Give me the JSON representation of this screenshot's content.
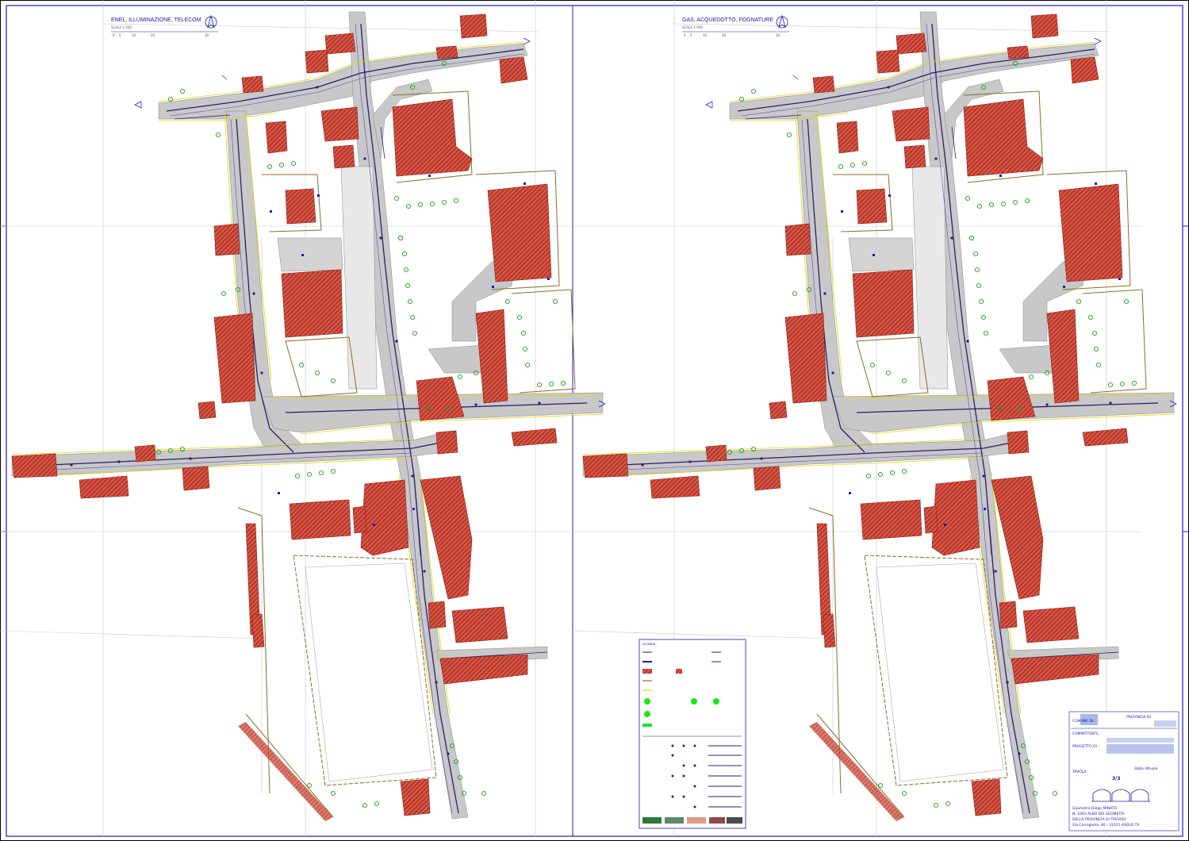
{
  "panels": [
    {
      "title": "ENEL, ILLUMINAZIONE, TELECOM",
      "scale_label": "SCALA 1:500",
      "scale_ticks": [
        "0",
        "5",
        "10",
        "20",
        "30"
      ]
    },
    {
      "title": "GAS, ACQUEDOTTO, FOGNATURE",
      "scale_label": "SCALA 1:500",
      "scale_ticks": [
        "0",
        "5",
        "10",
        "20",
        "30"
      ]
    }
  ],
  "legend": {
    "heading": "LEGENDA :",
    "sheet_number": "3/3"
  },
  "title_block": {
    "committente_label": "COMMITTENTE :",
    "progetto_label": "PROGETTO DI :",
    "tavola_label": "TAVOLA :",
    "comune_label": "COMUNE DI :",
    "provincia_label": "PROVINCIA DI",
    "stato_label": "Stato Attuale",
    "sheet": "3/3",
    "firm_lines": [
      "Geometra  Diego  MINATO",
      "N. 2463   ALBO DEI GEOMETRI",
      "DELLA PROVINCIA DI TREVISO",
      "Via Corrognola, 46 - 31011  ASOLO TV"
    ]
  },
  "colors": {
    "road": "#c8c8c8",
    "building": "#c0392b",
    "utility": "#2a1e6e",
    "curb": "#e6d800",
    "tree": "#19a319",
    "frame": "#1a1acc",
    "boundary": "#8a6d2b"
  }
}
